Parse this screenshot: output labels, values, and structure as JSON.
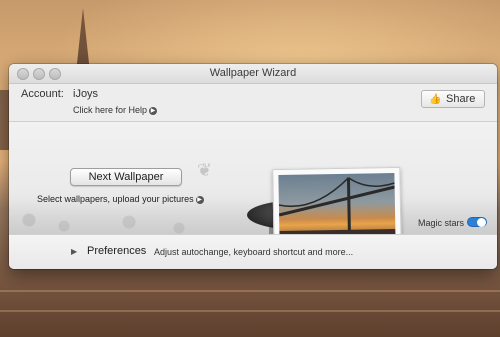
{
  "window": {
    "title": "Wallpaper Wizard"
  },
  "account": {
    "label": "Account:",
    "value": "iJoys",
    "help_link": "Click here for Help"
  },
  "share": {
    "label": "Share",
    "icon": "thumbs-up-icon"
  },
  "main": {
    "next_button": "Next Wallpaper",
    "select_link": "Select wallpapers, upload your pictures",
    "magic_stars_label": "Magic stars",
    "magic_stars_on": true
  },
  "preferences": {
    "title": "Preferences",
    "description": "Adjust autochange, keyboard shortcut and more..."
  },
  "colors": {
    "toggle_accent": "#2f7fd6"
  }
}
